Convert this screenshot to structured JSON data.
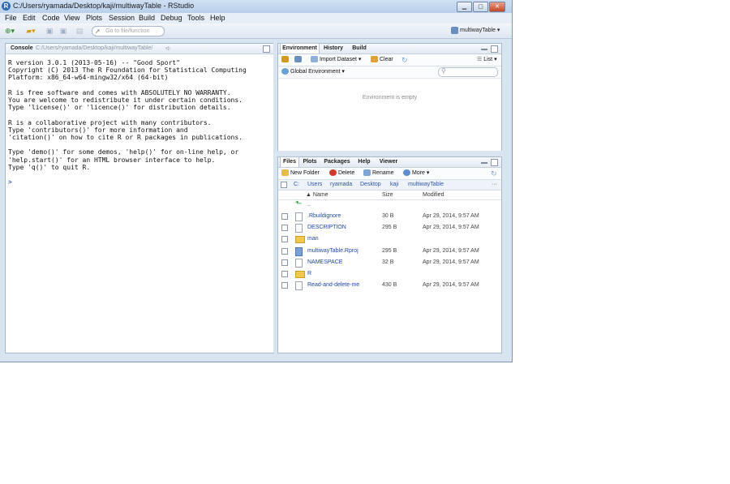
{
  "window": {
    "title": "C:/Users/ryamada/Desktop/kaji/multiwayTable - RStudio",
    "app_icon_letter": "R"
  },
  "menu": [
    "File",
    "Edit",
    "Code",
    "View",
    "Plots",
    "Session",
    "Build",
    "Debug",
    "Tools",
    "Help"
  ],
  "toolbar": {
    "goto_placeholder": "Go to file/function",
    "project_name": "multiwayTable ▾"
  },
  "console": {
    "tab_label": "Console",
    "path": "C:/Users/ryamada/Desktop/kaji/multiwayTable/",
    "lines": [
      "R version 3.0.1 (2013-05-16) -- \"Good Sport\"",
      "Copyright (C) 2013 The R Foundation for Statistical Computing",
      "Platform: x86_64-w64-mingw32/x64 (64-bit)",
      "",
      "R is free software and comes with ABSOLUTELY NO WARRANTY.",
      "You are welcome to redistribute it under certain conditions.",
      "Type 'license()' or 'licence()' for distribution details.",
      "",
      "R is a collaborative project with many contributors.",
      "Type 'contributors()' for more information and",
      "'citation()' on how to cite R or R packages in publications.",
      "",
      "Type 'demo()' for some demos, 'help()' for on-line help, or",
      "'help.start()' for an HTML browser interface to help.",
      "Type 'q()' to quit R."
    ],
    "prompt": ">"
  },
  "env_pane": {
    "tabs": [
      "Environment",
      "History",
      "Build"
    ],
    "import_label": "Import Dataset ▾",
    "clear_label": "Clear",
    "list_label": "List ▾",
    "scope_label": "Global Environment ▾",
    "empty_message": "Environment is empty"
  },
  "files_pane": {
    "tabs": [
      "Files",
      "Plots",
      "Packages",
      "Help",
      "Viewer"
    ],
    "new_folder": "New Folder",
    "delete": "Delete",
    "rename": "Rename",
    "more": "More ▾",
    "breadcrumb": [
      "C:",
      "Users",
      "ryamada",
      "Desktop",
      "kaji",
      "multiwayTable"
    ],
    "columns": {
      "name": "▲ Name",
      "size": "Size",
      "modified": "Modified"
    },
    "up_label": "..",
    "files": [
      {
        "name": ".Rbuildignore",
        "size": "30 B",
        "modified": "Apr 29, 2014, 9:57 AM",
        "kind": "file"
      },
      {
        "name": "DESCRIPTION",
        "size": "295 B",
        "modified": "Apr 29, 2014, 9:57 AM",
        "kind": "file"
      },
      {
        "name": "man",
        "size": "",
        "modified": "",
        "kind": "folder"
      },
      {
        "name": "multiwayTable.Rproj",
        "size": "295 B",
        "modified": "Apr 29, 2014, 9:57 AM",
        "kind": "rproj"
      },
      {
        "name": "NAMESPACE",
        "size": "32 B",
        "modified": "Apr 29, 2014, 9:57 AM",
        "kind": "file"
      },
      {
        "name": "R",
        "size": "",
        "modified": "",
        "kind": "folder"
      },
      {
        "name": "Read-and-delete-me",
        "size": "430 B",
        "modified": "Apr 29, 2014, 9:57 AM",
        "kind": "file"
      }
    ]
  }
}
